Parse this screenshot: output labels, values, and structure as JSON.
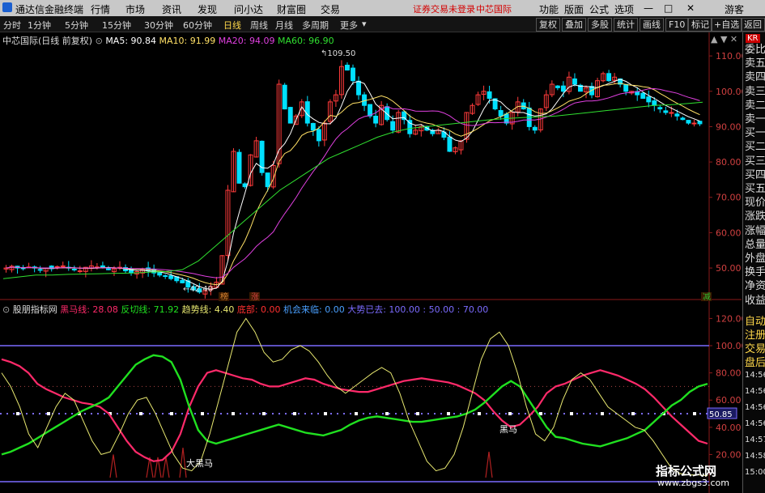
{
  "title_bar": {
    "app_title": "通达信金融终端",
    "menus": [
      "行情",
      "市场",
      "资讯",
      "发现",
      "问小达",
      "财富圈",
      "交易"
    ],
    "login_notice": "证券交易未登录",
    "stock_name": "中芯国际",
    "right_menus": [
      "功能",
      "版面",
      "公式",
      "选项"
    ],
    "guest": "游客"
  },
  "toolbar": {
    "periods": [
      "分时",
      "1分钟",
      "5分钟",
      "15分钟",
      "30分钟",
      "60分钟",
      "日线",
      "周线",
      "月线",
      "多周期",
      "更多"
    ],
    "active_period": "日线",
    "buttons": [
      "复权",
      "叠加",
      "多股",
      "统计",
      "画线",
      "F10",
      "标记",
      "+自选",
      "返回"
    ]
  },
  "main_info": {
    "stock": "中芯国际(日线 前复权)",
    "ma5": "MA5: 90.84",
    "ma10": "MA10: 91.99",
    "ma20": "MA20: 94.09",
    "ma60": "MA60: 96.90",
    "high_label": "109.50",
    "low_label": "42.40",
    "tag1": "榜",
    "tag2": "涨",
    "tag3": "减"
  },
  "indicator_info": {
    "name": "股朋指标网",
    "heima": "黑马线: 28.08",
    "fanqie": "反切线: 71.92",
    "qushi": "趋势线: 4.40",
    "dibu": "底部: 0.00",
    "jihui": "机会来临: 0.00",
    "dashi": "大势已去: 100.00 : 50.00 : 70.00",
    "label_heima": "黑马",
    "label_daheima": "大黑马",
    "current_value": "50.85"
  },
  "right_panel": {
    "kr": "KR",
    "items": [
      "委比",
      "卖五",
      "卖四",
      "卖三",
      "卖二",
      "卖一",
      "买一",
      "买二",
      "买三",
      "买四",
      "买五",
      "现价",
      "涨跌",
      "涨幅",
      "总量",
      "外盘",
      "换手",
      "净资",
      "收益"
    ],
    "bottom_items": [
      "自动",
      "注册",
      "交易",
      "盘后"
    ],
    "times": [
      "14:56",
      "14:56",
      "14:56",
      "14:56",
      "14:57",
      "14:58",
      "15:00"
    ]
  },
  "watermark": {
    "text": "指标公式网",
    "url": "www.zbgs3.com"
  },
  "colors": {
    "up": "#ff3a3a",
    "down": "#00e0ff",
    "ma5": "#ffffff",
    "ma10": "#ffe066",
    "ma20": "#e040e0",
    "ma60": "#30e030",
    "heima": "#ff2a6a",
    "fanqie": "#20e020",
    "qushi": "#e8e870",
    "dashi": "#7b6bff"
  },
  "chart_data": [
    {
      "type": "candlestick",
      "title": "中芯国际(日线 前复权)",
      "y_ticks": [
        50,
        60,
        70,
        80,
        90,
        100,
        110
      ],
      "ylim": [
        42,
        113
      ],
      "x_labels": [],
      "close": [
        50,
        50.5,
        50,
        49.8,
        50.3,
        50,
        49.5,
        50,
        49.8,
        50.4,
        50.6,
        50,
        49.6,
        49.2,
        50.2,
        50.6,
        50.3,
        50.1,
        49.5,
        49.8,
        50.2,
        49.2,
        48.6,
        49,
        49.6,
        49.2,
        48.6,
        48,
        47.6,
        47,
        46.4,
        45.8,
        44.6,
        43.8,
        43.2,
        43.6,
        44.8,
        46,
        53.5,
        72,
        83,
        74,
        73,
        82,
        86,
        77,
        73,
        79,
        102,
        95,
        91,
        93,
        97,
        91,
        89,
        86,
        91,
        97,
        99,
        107,
        106,
        103,
        99,
        96,
        93,
        91,
        96,
        92,
        89,
        94,
        92,
        88,
        89,
        90,
        89,
        88,
        89,
        87,
        83,
        84,
        86,
        94,
        96,
        99,
        100,
        98,
        95,
        93,
        91,
        94,
        97,
        95,
        90,
        89,
        95,
        99,
        102,
        101,
        100,
        104,
        102,
        100,
        101,
        99,
        103,
        105,
        103,
        104,
        102,
        100,
        100,
        99,
        98,
        97,
        96,
        95,
        94,
        94,
        93,
        92,
        91,
        91,
        90.8
      ],
      "ma60": [
        47,
        47.5,
        48,
        48,
        48.2,
        48.3,
        48.4,
        48.5,
        48.6,
        48.8,
        49,
        49.5,
        52,
        56,
        60,
        64,
        68,
        72,
        75,
        78,
        81,
        83,
        85,
        87,
        88.5,
        89.5,
        90,
        90.5,
        91,
        91.5,
        92,
        92.3,
        92.6,
        92.8,
        93,
        93.5,
        94,
        94.5,
        95,
        95.5,
        96,
        96.2,
        96.5,
        96.9
      ]
    },
    {
      "type": "line",
      "title": "股朋指标网",
      "y_ticks": [
        20,
        40,
        60,
        80,
        100,
        120
      ],
      "ylim": [
        3,
        125
      ],
      "series": [
        {
          "name": "黑马线",
          "values": [
            90,
            88,
            85,
            80,
            72,
            68,
            65,
            62,
            60,
            58,
            57,
            55,
            50,
            40,
            30,
            22,
            18,
            15,
            16,
            22,
            35,
            55,
            70,
            80,
            82,
            80,
            78,
            76,
            75,
            72,
            70,
            70,
            72,
            74,
            76,
            75,
            72,
            70,
            68,
            67,
            66,
            66,
            68,
            70,
            72,
            74,
            75,
            76,
            75,
            74,
            73,
            71,
            68,
            65,
            60,
            52,
            45,
            40,
            42,
            48,
            55,
            65,
            70,
            72,
            75,
            78,
            80,
            82,
            80,
            78,
            75,
            72,
            68,
            62,
            55,
            48,
            42,
            36,
            30,
            28
          ]
        },
        {
          "name": "反切线",
          "values": [
            20,
            22,
            25,
            28,
            32,
            36,
            40,
            44,
            48,
            52,
            55,
            58,
            62,
            70,
            78,
            86,
            90,
            93,
            92,
            88,
            75,
            55,
            38,
            30,
            28,
            30,
            32,
            34,
            36,
            38,
            40,
            42,
            40,
            38,
            36,
            35,
            34,
            36,
            38,
            42,
            45,
            47,
            48,
            47,
            46,
            45,
            44,
            44,
            45,
            46,
            47,
            48,
            50,
            53,
            58,
            64,
            70,
            74,
            70,
            60,
            50,
            40,
            33,
            32,
            30,
            28,
            27,
            26,
            28,
            30,
            32,
            35,
            38,
            44,
            50,
            56,
            60,
            66,
            70,
            72
          ]
        },
        {
          "name": "趋势线",
          "values": [
            80,
            70,
            55,
            35,
            25,
            40,
            55,
            65,
            60,
            45,
            30,
            20,
            22,
            35,
            50,
            60,
            62,
            50,
            35,
            20,
            10,
            8,
            15,
            35,
            60,
            85,
            110,
            120,
            110,
            95,
            88,
            90,
            97,
            100,
            96,
            88,
            78,
            70,
            65,
            70,
            75,
            80,
            84,
            80,
            65,
            45,
            30,
            15,
            8,
            10,
            20,
            40,
            65,
            90,
            105,
            110,
            100,
            80,
            55,
            35,
            30,
            40,
            60,
            75,
            80,
            75,
            65,
            55,
            50,
            45,
            40,
            38,
            30,
            20,
            10,
            6,
            5,
            5,
            4.4
          ]
        },
        {
          "name": "大势已去",
          "values": [
            100,
            50,
            70
          ]
        }
      ]
    }
  ]
}
